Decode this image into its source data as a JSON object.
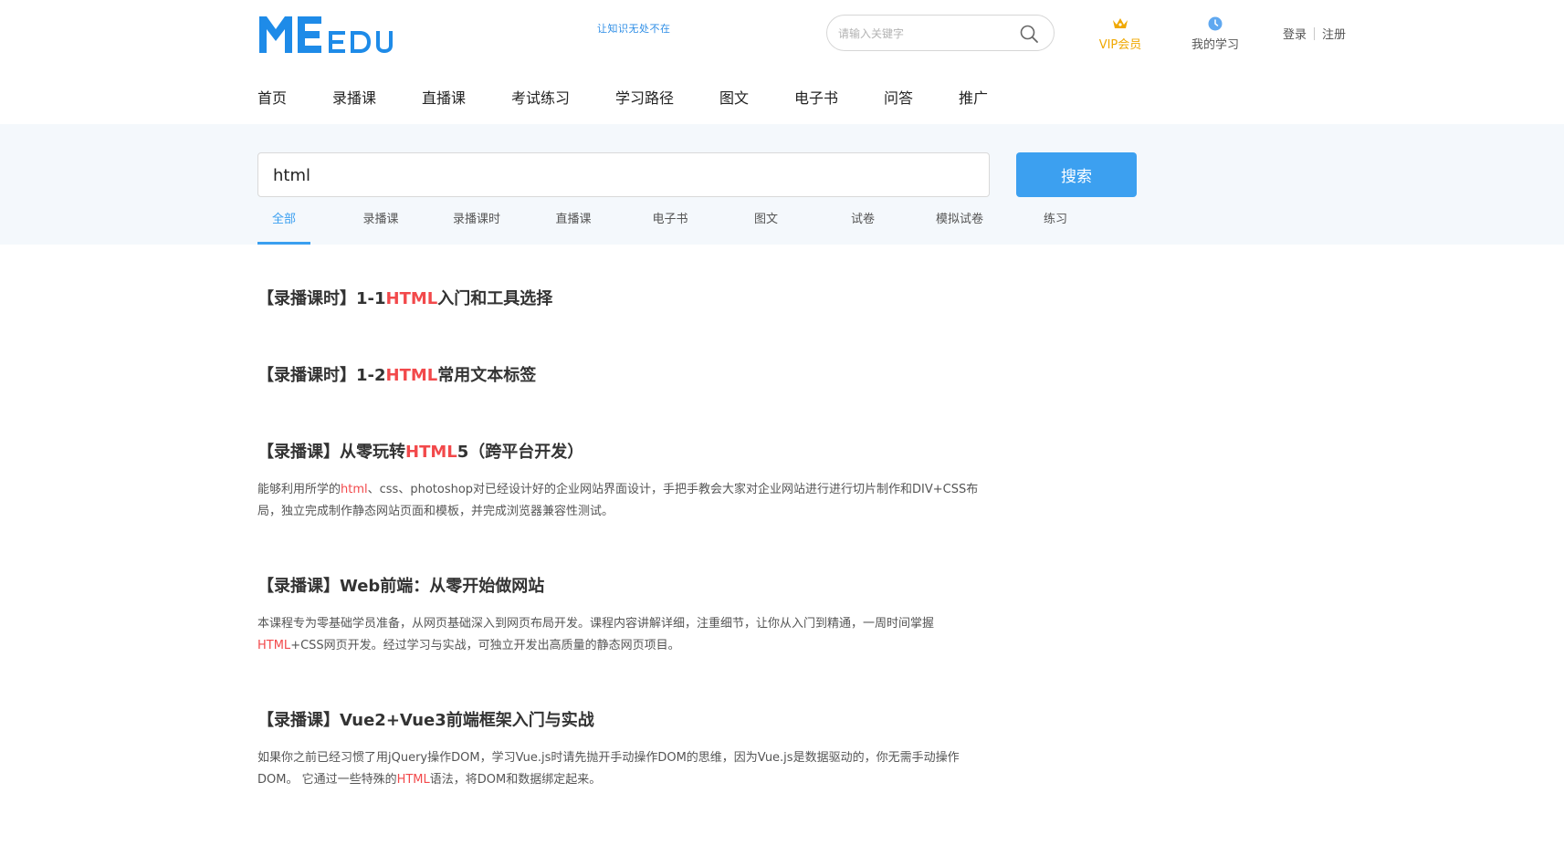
{
  "logo": {
    "text": "MEEDU",
    "slogan": "让知识无处不在",
    "color": "#1e8be8"
  },
  "header_search": {
    "placeholder": "请输入关键字",
    "icon": "search-icon"
  },
  "vip": {
    "label": "VIP会员",
    "icon": "crown-icon",
    "color": "#f0a800"
  },
  "my_study": {
    "label": "我的学习",
    "icon": "clock-icon"
  },
  "auth": {
    "login": "登录",
    "register": "注册"
  },
  "nav": [
    {
      "label": "首页"
    },
    {
      "label": "录播课"
    },
    {
      "label": "直播课"
    },
    {
      "label": "考试练习"
    },
    {
      "label": "学习路径"
    },
    {
      "label": "图文"
    },
    {
      "label": "电子书"
    },
    {
      "label": "问答"
    },
    {
      "label": "推广"
    }
  ],
  "search": {
    "value": "html",
    "button_label": "搜索"
  },
  "tabs": [
    {
      "label": "全部",
      "active": true
    },
    {
      "label": "录播课"
    },
    {
      "label": "录播课时"
    },
    {
      "label": "直播课"
    },
    {
      "label": "电子书"
    },
    {
      "label": "图文"
    },
    {
      "label": "试卷"
    },
    {
      "label": "模拟试卷"
    },
    {
      "label": "练习"
    }
  ],
  "colors": {
    "accent": "#3a9ff0",
    "highlight": "#f2494b",
    "band_bg": "#f4f8fc"
  },
  "results": [
    {
      "title": {
        "pre": "【录播课时】1-1",
        "hl": "HTML",
        "post": "入门和工具选择"
      }
    },
    {
      "title": {
        "pre": "【录播课时】1-2",
        "hl": "HTML",
        "post": "常用文本标签"
      }
    },
    {
      "title": {
        "pre": "【录播课】从零玩转",
        "hl": "HTML",
        "post": "5（跨平台开发）"
      },
      "desc": {
        "pre": "能够利用所学的",
        "hl": "html",
        "post": "、css、photoshop对已经设计好的企业网站界面设计，手把手教会大家对企业网站进行进行切片制作和DIV+CSS布局，独立完成制作静态网站页面和模板，并完成浏览器兼容性测试。"
      }
    },
    {
      "title": {
        "pre": "【录播课】Web前端：从零开始做网站",
        "hl": "",
        "post": ""
      },
      "desc": {
        "pre": "本课程专为零基础学员准备，从网页基础深入到网页布局开发。课程内容讲解详细，注重细节，让你从入门到精通，一周时间掌握",
        "hl": "HTML",
        "post": "+CSS网页开发。经过学习与实战，可独立开发出高质量的静态网页项目。"
      }
    },
    {
      "title": {
        "pre": "【录播课】Vue2+Vue3前端框架入门与实战",
        "hl": "",
        "post": ""
      },
      "desc": {
        "pre": "如果你之前已经习惯了用jQuery操作DOM，学习Vue.js时请先抛开手动操作DOM的思维，因为Vue.js是数据驱动的，你无需手动操作DOM。 它通过一些特殊的",
        "hl": "HTML",
        "post": "语法，将DOM和数据绑定起来。"
      }
    }
  ]
}
